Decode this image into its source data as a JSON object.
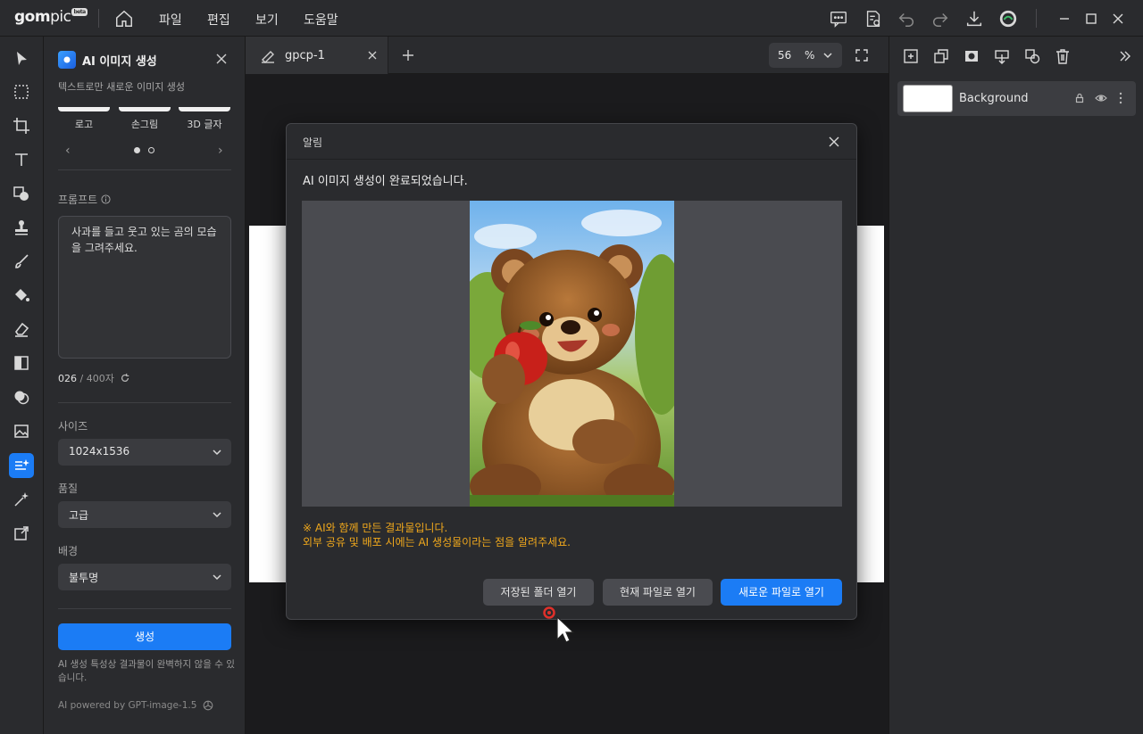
{
  "app": {
    "logo": "gom",
    "logo_pic": "pic",
    "logo_badge": "beta",
    "menu": [
      "파일",
      "편집",
      "보기",
      "도움말"
    ]
  },
  "panel": {
    "title": "AI 이미지 생성",
    "subtitle": "텍스트로만 새로운 이미지 생성",
    "styles": [
      "로고",
      "손그림",
      "3D 글자"
    ],
    "carousel_prev": "‹",
    "carousel_next": "›",
    "prompt_label": "프롬프트",
    "prompt_text": "사과를 들고 웃고 있는 곰의 모습을 그려주세요.",
    "char_count": "026",
    "char_max": " / 400자",
    "size_label": "사이즈",
    "size_value": "1024x1536",
    "quality_label": "품질",
    "quality_value": "고급",
    "background_label": "배경",
    "background_value": "불투명",
    "generate_label": "생성",
    "disclaimer": "AI 생성 특성상 결과물이 완벽하지 않을 수 있습니다.",
    "powered_by": "AI powered by GPT-image-1.5"
  },
  "tabs": {
    "doc_name": "gpcp-1",
    "zoom_value": "56",
    "zoom_unit": "%"
  },
  "layers": {
    "items": [
      {
        "name": "Background"
      }
    ]
  },
  "dialog": {
    "title": "알림",
    "message": "AI 이미지 생성이 완료되었습니다.",
    "warning_line1": "※ AI와 함께 만든 결과물입니다.",
    "warning_line2": "외부 공유 및 배포 시에는 AI 생성물이라는 점을 알려주세요.",
    "btn_open_folder": "저장된 폴더 열기",
    "btn_open_current": "현재 파일로 열기",
    "btn_open_new": "새로운 파일로 열기"
  },
  "colors": {
    "accent": "#1b7cf5",
    "warning": "#f0a81c",
    "panel_bg": "#2a2b2e"
  }
}
